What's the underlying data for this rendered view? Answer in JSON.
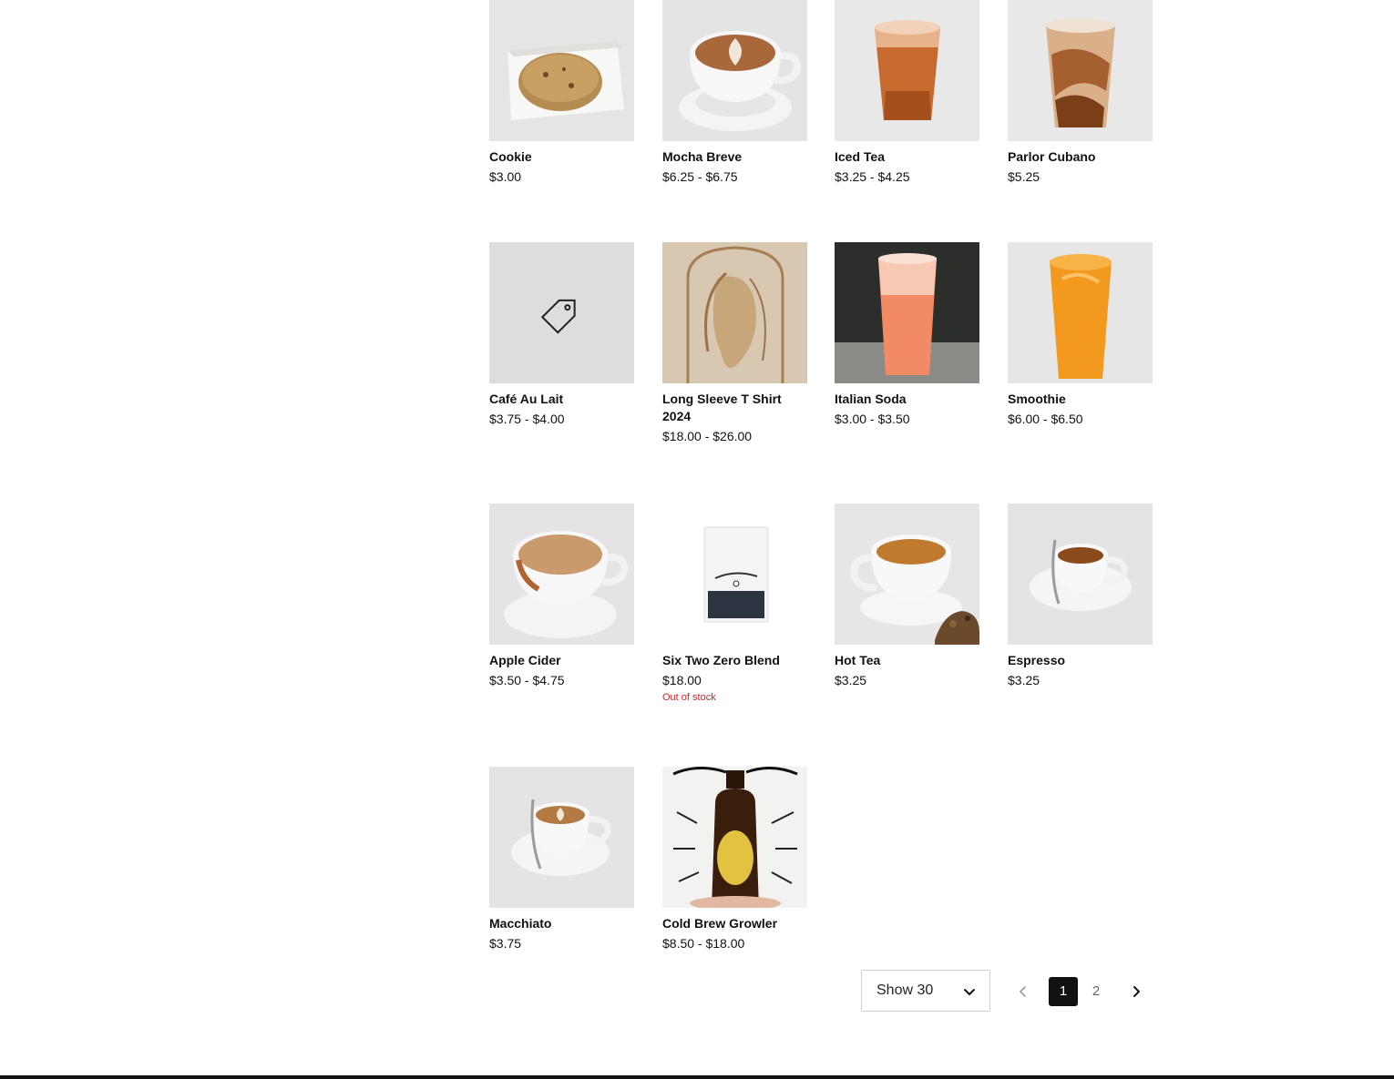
{
  "products": [
    {
      "name": "Cookie",
      "price": "$3.00",
      "stock": "",
      "image": "cookie-photo"
    },
    {
      "name": "Mocha Breve",
      "price": "$6.25 - $6.75",
      "stock": "",
      "image": "latte-cup-photo"
    },
    {
      "name": "Iced Tea",
      "price": "$3.25 - $4.25",
      "stock": "",
      "image": "iced-tea-glass-photo"
    },
    {
      "name": "Parlor Cubano",
      "price": "$5.25",
      "stock": "",
      "image": "iced-coffee-glass-photo"
    },
    {
      "name": "Café Au Lait",
      "price": "$3.75 - $4.00",
      "stock": "",
      "image": "tag-placeholder-icon"
    },
    {
      "name": "Long Sleeve T Shirt 2024",
      "price": "$18.00 - $26.00",
      "stock": "",
      "image": "shirt-artwork-photo"
    },
    {
      "name": "Italian Soda",
      "price": "$3.00 - $3.50",
      "stock": "",
      "image": "italian-soda-photo"
    },
    {
      "name": "Smoothie",
      "price": "$6.00 - $6.50",
      "stock": "",
      "image": "smoothie-photo"
    },
    {
      "name": "Apple Cider",
      "price": "$3.50 - $4.75",
      "stock": "",
      "image": "apple-cider-cup-photo"
    },
    {
      "name": "Six Two Zero Blend",
      "price": "$18.00",
      "stock": "Out of stock",
      "image": "coffee-bag-photo"
    },
    {
      "name": "Hot Tea",
      "price": "$3.25",
      "stock": "",
      "image": "hot-tea-cup-photo"
    },
    {
      "name": "Espresso",
      "price": "$3.25",
      "stock": "",
      "image": "espresso-cup-photo"
    },
    {
      "name": "Macchiato",
      "price": "$3.75",
      "stock": "",
      "image": "macchiato-cup-photo"
    },
    {
      "name": "Cold Brew Growler",
      "price": "$8.50 - $18.00",
      "stock": "",
      "image": "growler-photo"
    }
  ],
  "page_size": {
    "label": "Show 30"
  },
  "pagination": {
    "pages": [
      "1",
      "2"
    ],
    "current": "1"
  },
  "colors": {
    "out_of_stock": "#c92a2a",
    "active_page_bg": "#111111"
  }
}
